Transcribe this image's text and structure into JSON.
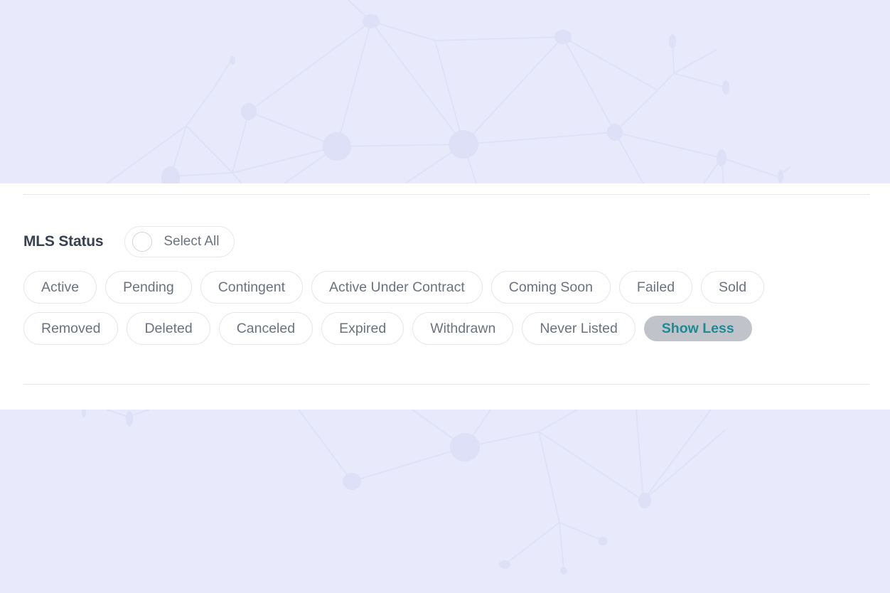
{
  "section": {
    "title": "MLS Status",
    "select_all_label": "Select All",
    "select_all_checked": false
  },
  "status_chips": [
    {
      "label": "Active",
      "selected": false
    },
    {
      "label": "Pending",
      "selected": false
    },
    {
      "label": "Contingent",
      "selected": false
    },
    {
      "label": "Active Under Contract",
      "selected": false
    },
    {
      "label": "Coming Soon",
      "selected": false
    },
    {
      "label": "Failed",
      "selected": false
    },
    {
      "label": "Sold",
      "selected": false
    },
    {
      "label": "Removed",
      "selected": false
    },
    {
      "label": "Deleted",
      "selected": false
    },
    {
      "label": "Canceled",
      "selected": false
    },
    {
      "label": "Expired",
      "selected": false
    },
    {
      "label": "Withdrawn",
      "selected": false
    },
    {
      "label": "Never Listed",
      "selected": false
    }
  ],
  "toggle": {
    "label": "Show Less"
  },
  "colors": {
    "background": "#e8eafb",
    "panel": "#ffffff",
    "chip_text": "#6b7280",
    "title_text": "#374151",
    "toggle_bg": "#c0c4ca",
    "toggle_text": "#1f8a95"
  }
}
